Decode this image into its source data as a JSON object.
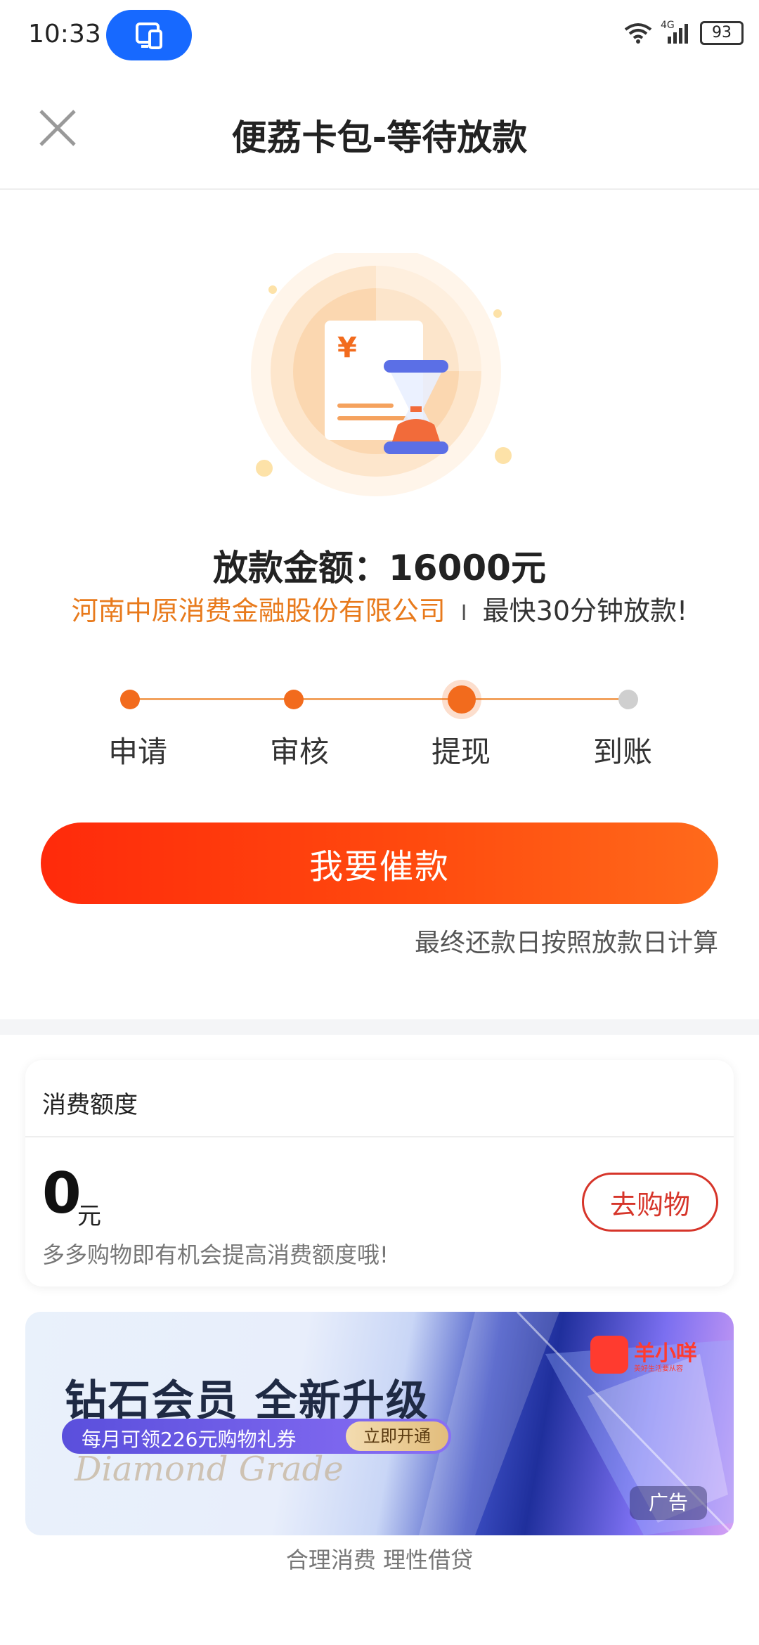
{
  "status_bar": {
    "time": "10:33",
    "battery": "93",
    "network": "4G"
  },
  "header": {
    "title": "便荔卡包-等待放款",
    "close_icon": "close-icon"
  },
  "loan": {
    "amount_text": "放款金额：16000元",
    "lender": "河南中原消费金融股份有限公司",
    "separator": "I",
    "speed": "最快30分钟放款!",
    "illustration_icon": "hourglass-receipt-icon"
  },
  "steps": [
    {
      "label": "申请",
      "state": "done"
    },
    {
      "label": "审核",
      "state": "done"
    },
    {
      "label": "提现",
      "state": "current"
    },
    {
      "label": "到账",
      "state": "todo"
    }
  ],
  "actions": {
    "urge_label": "我要催款",
    "note": "最终还款日按照放款日计算"
  },
  "quota_card": {
    "title": "消费额度",
    "amount": "0",
    "unit": "元",
    "shop_label": "去购物",
    "hint": "多多购物即有机会提高消费额度哦!"
  },
  "ad": {
    "title": "钻石会员  全新升级",
    "pill_text": "每月可领226元购物礼券",
    "open_label": "立即开通",
    "script_text": "Diamond Grade",
    "brand": "羊小咩",
    "brand_sub": "美好生活要从容",
    "tag": "广告"
  },
  "footer": {
    "text": "合理消费 理性借贷"
  },
  "colors": {
    "accent": "#f26b1d",
    "lender": "#e87a1c",
    "button_start": "#ff2a0b",
    "button_end": "#ff6a1b",
    "shop_border": "#d6352a",
    "step_todo": "#cfcfcf"
  }
}
